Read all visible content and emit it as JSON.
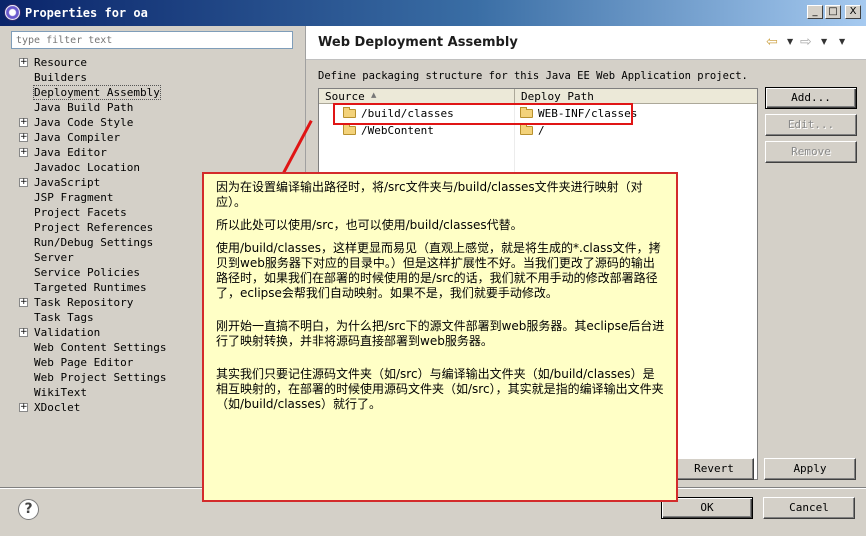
{
  "window": {
    "title": "Properties for oa",
    "minimize": "_",
    "maximize": "□",
    "close": "X"
  },
  "filter": {
    "placeholder": "type filter text"
  },
  "tree": [
    {
      "label": "Resource",
      "expandable": true
    },
    {
      "label": "Builders",
      "expandable": false
    },
    {
      "label": "Deployment Assembly",
      "expandable": false,
      "selected": true
    },
    {
      "label": "Java Build Path",
      "expandable": false
    },
    {
      "label": "Java Code Style",
      "expandable": true
    },
    {
      "label": "Java Compiler",
      "expandable": true
    },
    {
      "label": "Java Editor",
      "expandable": true
    },
    {
      "label": "Javadoc Location",
      "expandable": false
    },
    {
      "label": "JavaScript",
      "expandable": true
    },
    {
      "label": "JSP Fragment",
      "expandable": false
    },
    {
      "label": "Project Facets",
      "expandable": false
    },
    {
      "label": "Project References",
      "expandable": false
    },
    {
      "label": "Run/Debug Settings",
      "expandable": false
    },
    {
      "label": "Server",
      "expandable": false
    },
    {
      "label": "Service Policies",
      "expandable": false
    },
    {
      "label": "Targeted Runtimes",
      "expandable": false
    },
    {
      "label": "Task Repository",
      "expandable": true
    },
    {
      "label": "Task Tags",
      "expandable": false
    },
    {
      "label": "Validation",
      "expandable": true
    },
    {
      "label": "Web Content Settings",
      "expandable": false
    },
    {
      "label": "Web Page Editor",
      "expandable": false
    },
    {
      "label": "Web Project Settings",
      "expandable": false
    },
    {
      "label": "WikiText",
      "expandable": false
    },
    {
      "label": "XDoclet",
      "expandable": true
    }
  ],
  "page": {
    "title": "Web Deployment Assembly",
    "description": "Define packaging structure for this Java EE Web Application project.",
    "nav_back": "⇦",
    "nav_forward": "⇨",
    "nav_drop": "▼",
    "menu_drop": "▼"
  },
  "table": {
    "col_source": "Source",
    "col_deploy": "Deploy Path",
    "sort_arrow": "▲",
    "rows": [
      {
        "source": "/build/classes",
        "deploy": "WEB-INF/classes"
      },
      {
        "source": "/WebContent",
        "deploy": "/"
      }
    ]
  },
  "buttons": {
    "add": "Add...",
    "edit": "Edit...",
    "remove": "Remove",
    "revert": "Revert",
    "apply": "Apply",
    "ok": "OK",
    "cancel": "Cancel"
  },
  "help": {
    "glyph": "?"
  },
  "callout": {
    "p1": "因为在设置编译输出路径时，将/src文件夹与/build/classes文件夹进行映射（对应）。",
    "p2": "所以此处可以使用/src，也可以使用/build/classes代替。",
    "p3": "使用/build/classes，这样更显而易见（直观上感觉，就是将生成的*.class文件，拷贝到web服务器下对应的目录中。）但是这样扩展性不好。当我们更改了源码的输出路径时，如果我们在部署的时候使用的是/src的话，我们就不用手动的修改部署路径了，eclipse会帮我们自动映射。如果不是，我们就要手动修改。",
    "p4": "刚开始一直搞不明白，为什么把/src下的源文件部署到web服务器。其eclipse后台进行了映射转换，并非将源码直接部署到web服务器。",
    "p5": "其实我们只要记住源码文件夹（如/src）与编译输出文件夹（如/build/classes）是相互映射的，在部署的时候使用源码文件夹（如/src），其实就是指的编译输出文件夹（如/build/classes）就行了。"
  },
  "colors": {
    "highlight": "#e01515",
    "callout_bg": "#ffffc6",
    "callout_border": "#d32b2b",
    "titlebar": "#0a246a"
  }
}
